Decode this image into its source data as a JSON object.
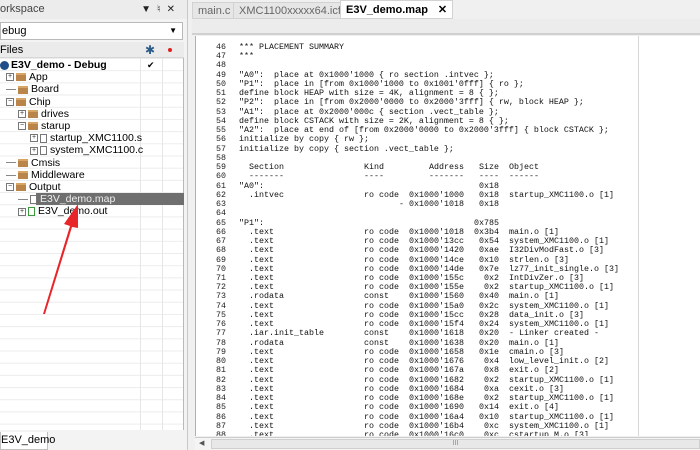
{
  "workspace": {
    "title": "orkspace",
    "config": "ebug",
    "files_header": "Files",
    "bottom_tab": "E3V_demo",
    "check": "✔",
    "tree": [
      {
        "label": "E3V_demo - Debug",
        "type": "project",
        "indent": 0,
        "bold": true
      },
      {
        "label": "App",
        "type": "folder",
        "indent": 1,
        "exp": "+"
      },
      {
        "label": "Board",
        "type": "folder",
        "indent": 1,
        "exp": ""
      },
      {
        "label": "Chip",
        "type": "folder",
        "indent": 1,
        "exp": "-"
      },
      {
        "label": "drives",
        "type": "folder",
        "indent": 2,
        "exp": "+"
      },
      {
        "label": "starup",
        "type": "folder",
        "indent": 2,
        "exp": "-"
      },
      {
        "label": "startup_XMC1100.s",
        "type": "file",
        "indent": 3,
        "exp": "+"
      },
      {
        "label": "system_XMC1100.c",
        "type": "file",
        "indent": 3,
        "exp": "+"
      },
      {
        "label": "Cmsis",
        "type": "folder",
        "indent": 1,
        "exp": ""
      },
      {
        "label": "Middleware",
        "type": "folder",
        "indent": 1,
        "exp": ""
      },
      {
        "label": "Output",
        "type": "folder",
        "indent": 1,
        "exp": "-"
      },
      {
        "label": "E3V_demo.map",
        "type": "file",
        "indent": 2,
        "exp": "",
        "selected": true
      },
      {
        "label": "E3V_demo.out",
        "type": "file-green",
        "indent": 2,
        "exp": "+"
      }
    ]
  },
  "editor": {
    "tabs": [
      {
        "label": "main.c"
      },
      {
        "label": "XMC1100xxxxx64.icf"
      },
      {
        "label": "E3V_demo.map",
        "active": true
      }
    ],
    "close": "✕",
    "lines": [
      {
        "n": "46",
        "t": "*** PLACEMENT SUMMARY"
      },
      {
        "n": "47",
        "t": "***"
      },
      {
        "n": "48",
        "t": ""
      },
      {
        "n": "49",
        "t": "\"A0\":  place at 0x1000'1000 { ro section .intvec };"
      },
      {
        "n": "50",
        "t": "\"P1\":  place in [from 0x1000'1000 to 0x1001'0fff] { ro };"
      },
      {
        "n": "51",
        "t": "define block HEAP with size = 4K, alignment = 8 { };"
      },
      {
        "n": "52",
        "t": "\"P2\":  place in [from 0x2000'0000 to 0x2000'3fff] { rw, block HEAP };"
      },
      {
        "n": "53",
        "t": "\"A1\":  place at 0x2000'000c { section .vect_table };"
      },
      {
        "n": "54",
        "t": "define block CSTACK with size = 2K, alignment = 8 { };"
      },
      {
        "n": "55",
        "t": "\"A2\":  place at end of [from 0x2000'0000 to 0x2000'3fff] { block CSTACK };"
      },
      {
        "n": "56",
        "t": "initialize by copy { rw };"
      },
      {
        "n": "57",
        "t": "initialize by copy { section .vect_table };"
      },
      {
        "n": "58",
        "t": ""
      },
      {
        "n": "59",
        "c": [
          "  Section",
          "Kind",
          "Address",
          "Size",
          "Object"
        ],
        "hdr": true
      },
      {
        "n": "60",
        "c": [
          "  -------",
          "----",
          "-------",
          "----",
          "------"
        ],
        "hdr": true
      },
      {
        "n": "61",
        "c": [
          "\"A0\":",
          "",
          "",
          "0x18",
          ""
        ]
      },
      {
        "n": "62",
        "c": [
          "  .intvec",
          "ro code",
          "0x1000'1000",
          "0x18",
          "startup_XMC1100.o [1]"
        ]
      },
      {
        "n": "63",
        "c": [
          "",
          "",
          "- 0x1000'1018",
          "0x18",
          ""
        ]
      },
      {
        "n": "64",
        "t": ""
      },
      {
        "n": "65",
        "c": [
          "\"P1\":",
          "",
          "",
          "0x785",
          ""
        ]
      },
      {
        "n": "66",
        "c": [
          "  .text",
          "ro code",
          "0x1000'1018",
          "0x3b4",
          "main.o [1]"
        ]
      },
      {
        "n": "67",
        "c": [
          "  .text",
          "ro code",
          "0x1000'13cc",
          "0x54",
          "system_XMC1100.o [1]"
        ]
      },
      {
        "n": "68",
        "c": [
          "  .text",
          "ro code",
          "0x1000'1420",
          "0xae",
          "I32DivModFast.o [3]"
        ]
      },
      {
        "n": "69",
        "c": [
          "  .text",
          "ro code",
          "0x1000'14ce",
          "0x10",
          "strlen.o [3]"
        ]
      },
      {
        "n": "70",
        "c": [
          "  .text",
          "ro code",
          "0x1000'14de",
          "0x7e",
          "lz77_init_single.o [3]"
        ]
      },
      {
        "n": "71",
        "c": [
          "  .text",
          "ro code",
          "0x1000'155c",
          "0x2",
          "IntDivZer.o [3]"
        ]
      },
      {
        "n": "72",
        "c": [
          "  .text",
          "ro code",
          "0x1000'155e",
          "0x2",
          "startup_XMC1100.o [1]"
        ]
      },
      {
        "n": "73",
        "c": [
          "  .rodata",
          "const",
          "0x1000'1560",
          "0x40",
          "main.o [1]"
        ]
      },
      {
        "n": "74",
        "c": [
          "  .text",
          "ro code",
          "0x1000'15a0",
          "0x2c",
          "system_XMC1100.o [1]"
        ]
      },
      {
        "n": "75",
        "c": [
          "  .text",
          "ro code",
          "0x1000'15cc",
          "0x28",
          "data_init.o [3]"
        ]
      },
      {
        "n": "76",
        "c": [
          "  .text",
          "ro code",
          "0x1000'15f4",
          "0x24",
          "system_XMC1100.o [1]"
        ]
      },
      {
        "n": "77",
        "c": [
          "  .iar.init_table",
          "const",
          "0x1000'1618",
          "0x20",
          "- Linker created -"
        ]
      },
      {
        "n": "78",
        "c": [
          "  .rodata",
          "const",
          "0x1000'1638",
          "0x20",
          "main.o [1]"
        ]
      },
      {
        "n": "79",
        "c": [
          "  .text",
          "ro code",
          "0x1000'1658",
          "0x1e",
          "cmain.o [3]"
        ]
      },
      {
        "n": "80",
        "c": [
          "  .text",
          "ro code",
          "0x1000'1676",
          "0x4",
          "low_level_init.o [2]"
        ]
      },
      {
        "n": "81",
        "c": [
          "  .text",
          "ro code",
          "0x1000'167a",
          "0x8",
          "exit.o [2]"
        ]
      },
      {
        "n": "82",
        "c": [
          "  .text",
          "ro code",
          "0x1000'1682",
          "0x2",
          "startup_XMC1100.o [1]"
        ]
      },
      {
        "n": "83",
        "c": [
          "  .text",
          "ro code",
          "0x1000'1684",
          "0xa",
          "cexit.o [3]"
        ]
      },
      {
        "n": "84",
        "c": [
          "  .text",
          "ro code",
          "0x1000'168e",
          "0x2",
          "startup_XMC1100.o [1]"
        ]
      },
      {
        "n": "85",
        "c": [
          "  .text",
          "ro code",
          "0x1000'1690",
          "0x14",
          "exit.o [4]"
        ]
      },
      {
        "n": "86",
        "c": [
          "  .text",
          "ro code",
          "0x1000'16a4",
          "0x10",
          "startup_XMC1100.o [1]"
        ]
      },
      {
        "n": "87",
        "c": [
          "  .text",
          "ro code",
          "0x1000'16b4",
          "0xc",
          "system_XMC1100.o [1]"
        ]
      },
      {
        "n": "88",
        "c": [
          "  .text",
          "ro code",
          "0x1000'16c0",
          "0xc",
          "cstartup_M.o [3]"
        ]
      }
    ]
  },
  "colors": {
    "selection": "#6f6f6f",
    "arrow": "#e8262a",
    "project": "#1e4f8a"
  }
}
